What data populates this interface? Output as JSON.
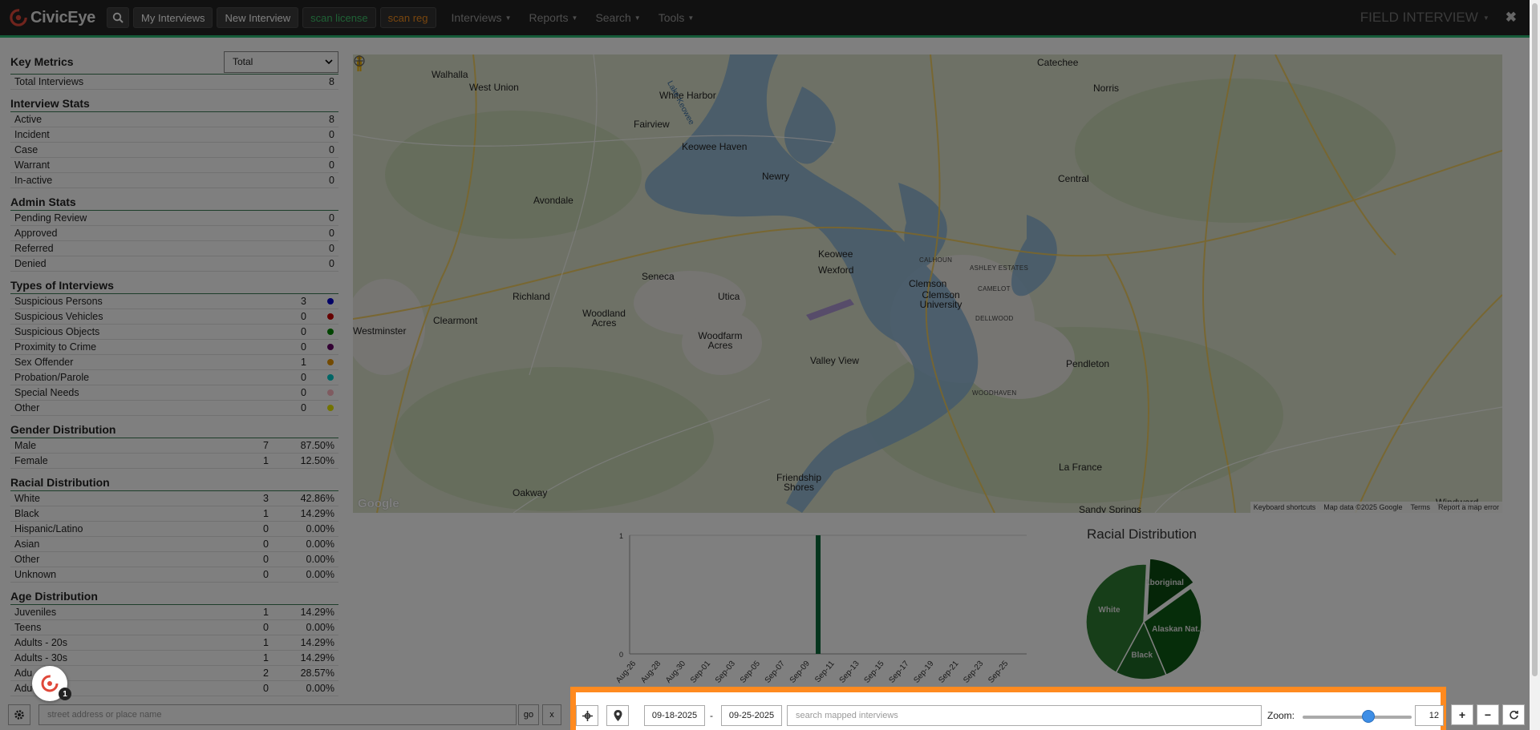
{
  "navbar": {
    "brand": "CivicEye",
    "buttons": [
      "My Interviews",
      "New Interview"
    ],
    "scan_license": "scan license",
    "scan_reg": "scan reg",
    "menus": [
      "Interviews",
      "Reports",
      "Search",
      "Tools"
    ],
    "module_title": "FIELD INTERVIEW",
    "close": "✖"
  },
  "sidebar": {
    "key_metrics": {
      "title": "Key Metrics",
      "select_value": "Total",
      "rows": [
        {
          "label": "Total Interviews",
          "count": "8"
        }
      ]
    },
    "interview_stats": {
      "title": "Interview Stats",
      "rows": [
        {
          "label": "Active",
          "count": "8"
        },
        {
          "label": "Incident",
          "count": "0"
        },
        {
          "label": "Case",
          "count": "0"
        },
        {
          "label": "Warrant",
          "count": "0"
        },
        {
          "label": "In-active",
          "count": "0"
        }
      ]
    },
    "admin_stats": {
      "title": "Admin Stats",
      "rows": [
        {
          "label": "Pending Review",
          "count": "0"
        },
        {
          "label": "Approved",
          "count": "0"
        },
        {
          "label": "Referred",
          "count": "0"
        },
        {
          "label": "Denied",
          "count": "0"
        }
      ]
    },
    "types": {
      "title": "Types of Interviews",
      "rows": [
        {
          "label": "Suspicious Persons",
          "count": "3",
          "color": "#0000cc"
        },
        {
          "label": "Suspicious Vehicles",
          "count": "0",
          "color": "#cc0000"
        },
        {
          "label": "Suspicious Objects",
          "count": "0",
          "color": "#008800"
        },
        {
          "label": "Proximity to Crime",
          "count": "0",
          "color": "#660066"
        },
        {
          "label": "Sex Offender",
          "count": "1",
          "color": "#e69500"
        },
        {
          "label": "Probation/Parole",
          "count": "0",
          "color": "#00cccc"
        },
        {
          "label": "Special Needs",
          "count": "0",
          "color": "#ffb6c1"
        },
        {
          "label": "Other",
          "count": "0",
          "color": "#e6e600"
        }
      ]
    },
    "gender": {
      "title": "Gender Distribution",
      "rows": [
        {
          "label": "Male",
          "count": "7",
          "pct": "87.50%"
        },
        {
          "label": "Female",
          "count": "1",
          "pct": "12.50%"
        }
      ]
    },
    "racial": {
      "title": "Racial Distribution",
      "rows": [
        {
          "label": "White",
          "count": "3",
          "pct": "42.86%"
        },
        {
          "label": "Black",
          "count": "1",
          "pct": "14.29%"
        },
        {
          "label": "Hispanic/Latino",
          "count": "0",
          "pct": "0.00%"
        },
        {
          "label": "Asian",
          "count": "0",
          "pct": "0.00%"
        },
        {
          "label": "Other",
          "count": "0",
          "pct": "0.00%"
        },
        {
          "label": "Unknown",
          "count": "0",
          "pct": "0.00%"
        }
      ]
    },
    "age": {
      "title": "Age Distribution",
      "rows": [
        {
          "label": "Juveniles",
          "count": "1",
          "pct": "14.29%"
        },
        {
          "label": "Teens",
          "count": "0",
          "pct": "0.00%"
        },
        {
          "label": "Adults - 20s",
          "count": "1",
          "pct": "14.29%"
        },
        {
          "label": "Adults - 30s",
          "count": "1",
          "pct": "14.29%"
        },
        {
          "label": "Adu",
          "count": "2",
          "pct": "28.57%"
        },
        {
          "label": "Adu",
          "count": "0",
          "pct": "0.00%"
        }
      ]
    }
  },
  "map": {
    "places": [
      {
        "name": "Walhalla"
      },
      {
        "name": "West Union"
      },
      {
        "name": "White Harbor"
      },
      {
        "name": "Fairview"
      },
      {
        "name": "Keowee Haven"
      },
      {
        "name": "Newry"
      },
      {
        "name": "Avondale"
      },
      {
        "name": "Seneca"
      },
      {
        "name": "Utica"
      },
      {
        "name": "Keowee"
      },
      {
        "name": "Wexford"
      },
      {
        "name": "Richland"
      },
      {
        "name": "Clearmont"
      },
      {
        "name": "Woodland Acres"
      },
      {
        "name": "Westminster"
      },
      {
        "name": "Woodfarm Acres"
      },
      {
        "name": "Valley View"
      },
      {
        "name": "Clemson"
      },
      {
        "name": "Clemson University"
      },
      {
        "name": "Catechee"
      },
      {
        "name": "Norris"
      },
      {
        "name": "Central"
      },
      {
        "name": "Pendleton"
      },
      {
        "name": "La France"
      },
      {
        "name": "Oakway"
      },
      {
        "name": "Friendship Shores"
      },
      {
        "name": "Sandy Springs"
      },
      {
        "name": "Windward"
      }
    ],
    "small_places": [
      {
        "name": "CALHOUN"
      },
      {
        "name": "ASHLEY ESTATES"
      },
      {
        "name": "CAMELOT"
      },
      {
        "name": "DELLWOOD"
      },
      {
        "name": "WOODHAVEN"
      }
    ],
    "lake_label": "Lake Keowee",
    "google": "Google",
    "footer": [
      "Keyboard shortcuts",
      "Map data ©2025 Google",
      "Terms",
      "Report a map error"
    ]
  },
  "chart_data": [
    {
      "type": "bar",
      "categories": [
        "Aug-26",
        "Aug-28",
        "Aug-30",
        "Sep-01",
        "Sep-03",
        "Sep-05",
        "Sep-07",
        "Sep-09",
        "Sep-11",
        "Sep-13",
        "Sep-15",
        "Sep-17",
        "Sep-19",
        "Sep-21",
        "Sep-23",
        "Sep-25"
      ],
      "values": [
        0,
        0,
        0,
        0,
        0,
        0,
        0,
        1,
        0,
        0,
        0,
        0,
        0,
        0,
        0,
        0
      ],
      "ylim": [
        0,
        1
      ],
      "y_ticks": [
        "0",
        "1"
      ],
      "color": "#0b6b3a"
    },
    {
      "type": "pie",
      "title": "Racial Distribution",
      "slices": [
        {
          "label": "White",
          "value": 42.86,
          "color": "#2f7d32"
        },
        {
          "label": "Black",
          "value": 14.29,
          "color": "#1f6b26"
        },
        {
          "label": "Alaskan Nat...",
          "value": 28.57,
          "color": "#0d5a14"
        },
        {
          "label": "Aboriginal",
          "value": 14.29,
          "color": "#0a4a10"
        }
      ]
    }
  ],
  "bottom": {
    "address_placeholder": "street address or place name",
    "go": "go",
    "x": "x",
    "date_from": "09-18-2025",
    "dash": "-",
    "date_to": "09-25-2025",
    "search_placeholder": "search mapped interviews",
    "zoom_label": "Zoom:",
    "zoom_value": "12",
    "zoom_min": 0,
    "zoom_max": 20,
    "plus": "+",
    "minus": "−"
  },
  "fab_badge": "1"
}
